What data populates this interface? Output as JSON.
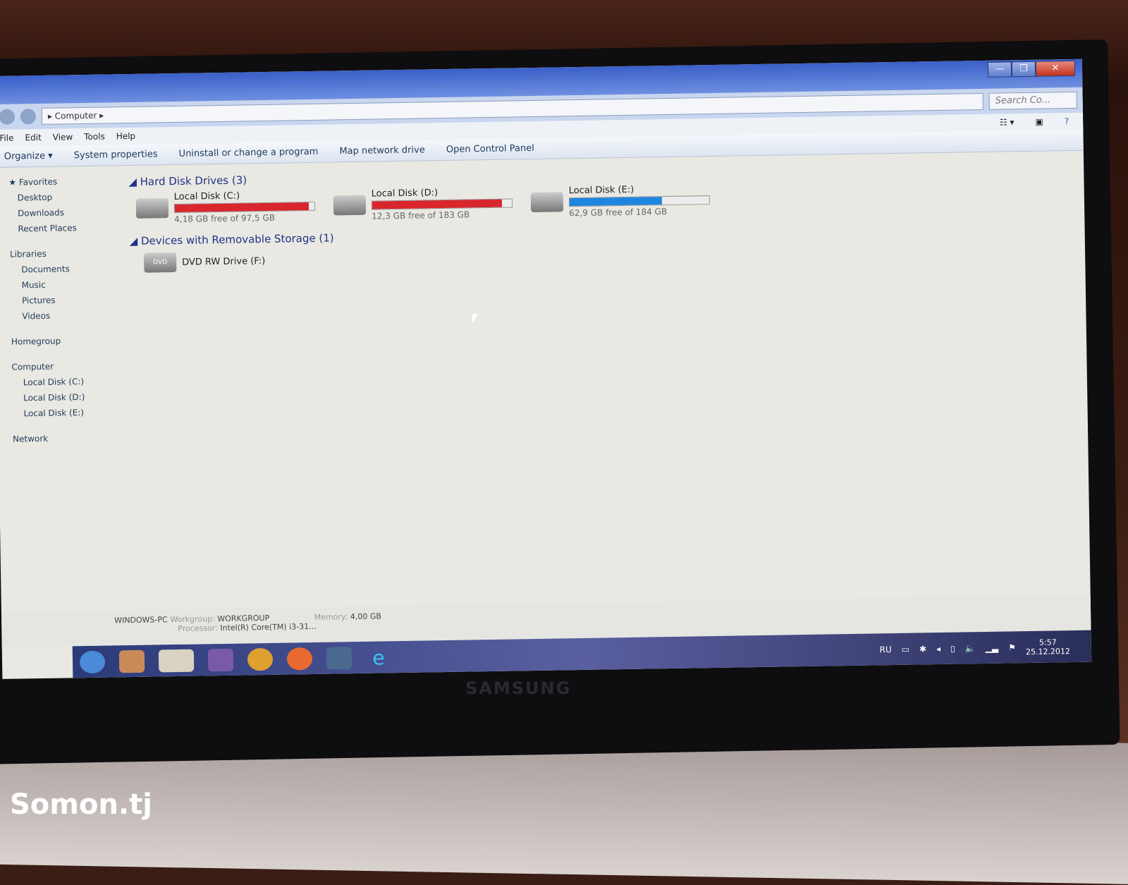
{
  "window": {
    "controls": [
      "minimize",
      "restore",
      "close"
    ],
    "breadcrumb": "Computer",
    "search_placeholder": "Search Co..."
  },
  "menu": [
    "File",
    "Edit",
    "View",
    "Tools",
    "Help"
  ],
  "toolbar": [
    "Organize ▾",
    "System properties",
    "Uninstall or change a program",
    "Map network drive",
    "Open Control Panel"
  ],
  "sidebar": {
    "favorites": [
      "Favorites",
      "Desktop",
      "Downloads",
      "Recent Places"
    ],
    "libraries": [
      "Libraries",
      "Documents",
      "Music",
      "Pictures",
      "Videos"
    ],
    "homegroup": "Homegroup",
    "computer": [
      "Computer",
      "Local Disk (C:)",
      "Local Disk (D:)",
      "Local Disk (E:)"
    ],
    "network": "Network"
  },
  "hard_disks": {
    "header": "Hard Disk Drives (3)",
    "drives": [
      {
        "name": "Local Disk (C:)",
        "free": "4,18 GB free of 97,5 GB",
        "used_percent": 96,
        "color": "#d8262c"
      },
      {
        "name": "Local Disk (D:)",
        "free": "12,3 GB free of 183 GB",
        "used_percent": 93,
        "color": "#d8262c"
      },
      {
        "name": "Local Disk (E:)",
        "free": "62,9 GB free of 184 GB",
        "used_percent": 66,
        "color": "#1f86e0"
      }
    ]
  },
  "removable": {
    "header": "Devices with Removable Storage (1)",
    "devices": [
      {
        "name": "DVD RW Drive (F:)",
        "badge": "DVD"
      }
    ]
  },
  "details": {
    "pc": "WINDOWS-PC",
    "workgroup_label": "Workgroup:",
    "workgroup": "WORKGROUP",
    "memory_label": "Memory:",
    "memory": "4,00 GB",
    "processor_label": "Processor:",
    "processor": "Intel(R) Core(TM) i3-31..."
  },
  "tray": {
    "lang": "RU",
    "time": "5:57",
    "date": "25.12.2012"
  },
  "bezel_brand": "SAMSUNG",
  "watermark": "Somon.tj"
}
